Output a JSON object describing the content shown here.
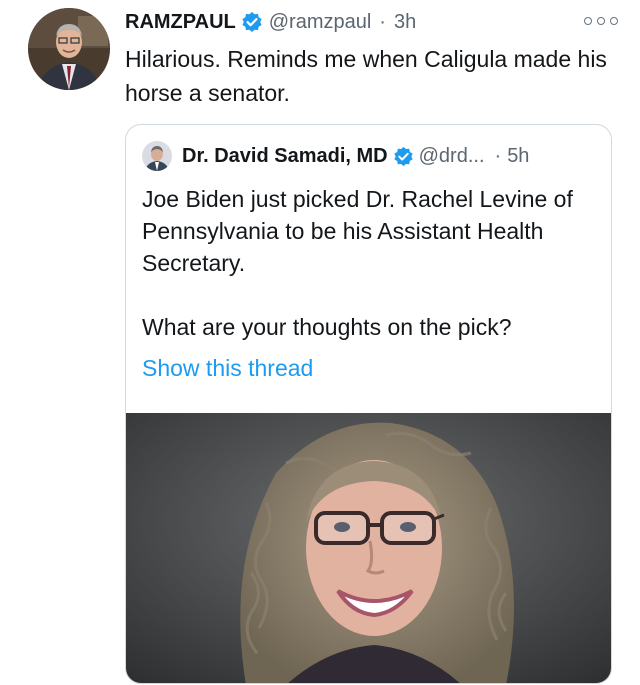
{
  "tweet": {
    "author_name": "RAMZPAUL",
    "author_handle": "@ramzpaul",
    "separator": "·",
    "time": "3h",
    "text": "Hilarious. Reminds me when Caligula made his horse a senator.",
    "verified_icon": "verified-badge-icon",
    "more_icon": "more-options-icon"
  },
  "quote": {
    "author_name": "Dr. David Samadi, MD",
    "author_handle": "@drd...",
    "separator": "·",
    "time": "5h",
    "paragraphs": [
      "Joe Biden just picked Dr. Rachel Levine of Pennsylvania to be his Assistant Health Secretary.",
      "What are your thoughts on the pick?"
    ],
    "show_thread": "Show this thread",
    "image_icon": "portrait-photo"
  },
  "colors": {
    "link": "#1d9bf0",
    "verified": "#1d9bf0",
    "secondary_text": "#5b6670",
    "border": "#cfd9de"
  }
}
